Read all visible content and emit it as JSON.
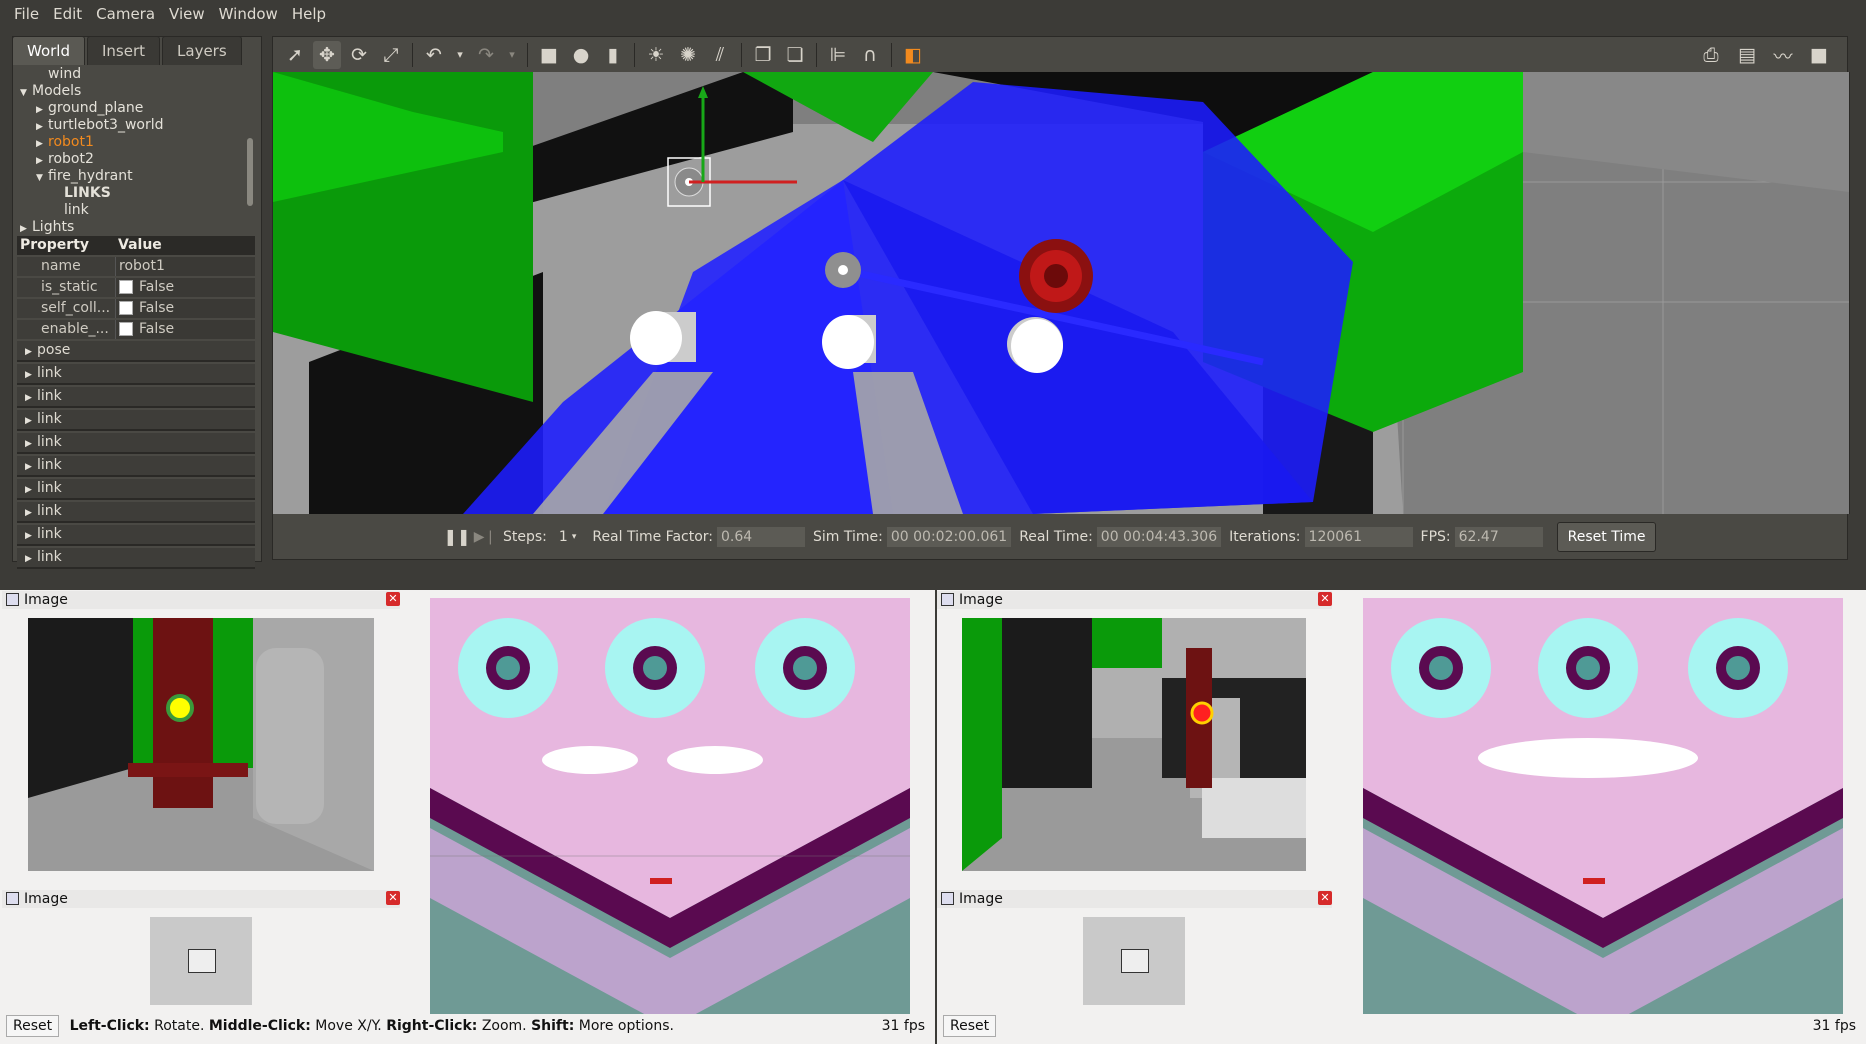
{
  "menu": [
    "File",
    "Edit",
    "Camera",
    "View",
    "Window",
    "Help"
  ],
  "tabs": [
    "World",
    "Insert",
    "Layers"
  ],
  "tree": [
    {
      "label": "wind",
      "indent": 1,
      "arrow": ""
    },
    {
      "label": "Models",
      "indent": 0,
      "arrow": "down"
    },
    {
      "label": "ground_plane",
      "indent": 1,
      "arrow": "right"
    },
    {
      "label": "turtlebot3_world",
      "indent": 1,
      "arrow": "right"
    },
    {
      "label": "robot1",
      "indent": 1,
      "arrow": "right",
      "selected": true
    },
    {
      "label": "robot2",
      "indent": 1,
      "arrow": "right"
    },
    {
      "label": "fire_hydrant",
      "indent": 1,
      "arrow": "down"
    },
    {
      "label": "LINKS",
      "indent": 2,
      "arrow": "",
      "bold": true
    },
    {
      "label": "link",
      "indent": 2,
      "arrow": ""
    },
    {
      "label": "Lights",
      "indent": 0,
      "arrow": "right"
    }
  ],
  "props": {
    "header": [
      "Property",
      "Value"
    ],
    "rows": [
      {
        "name": "name",
        "value": "robot1",
        "check": false
      },
      {
        "name": "is_static",
        "value": "False",
        "check": true
      },
      {
        "name": "self_coll...",
        "value": "False",
        "check": true
      },
      {
        "name": "enable_...",
        "value": "False",
        "check": true
      }
    ],
    "groups": [
      "pose",
      "link",
      "link",
      "link",
      "link",
      "link",
      "link",
      "link",
      "link",
      "link"
    ]
  },
  "bottombar": {
    "steps_label": "Steps:",
    "steps_value": "1",
    "rtf_label": "Real Time Factor:",
    "rtf_value": "0.64",
    "sim_label": "Sim Time:",
    "sim_value": "00 00:02:00.061",
    "real_label": "Real Time:",
    "real_value": "00 00:04:43.306",
    "iter_label": "Iterations:",
    "iter_value": "120061",
    "fps_label": "FPS:",
    "fps_value": "62.47",
    "reset_label": "Reset Time"
  },
  "panes": {
    "image_title": "Image",
    "reset": "Reset",
    "help_left_click": "Left-Click:",
    "help_rotate": "Rotate.",
    "help_middle_click": "Middle-Click:",
    "help_move": "Move X/Y.",
    "help_right_click": "Right-Click:",
    "help_zoom": "Zoom.",
    "help_shift": "Shift:",
    "help_more": "More options.",
    "fps_left": "31 fps",
    "fps_right": "31 fps"
  },
  "colors": {
    "accent": "#f28a1e",
    "wall_green": "#0dbd0d",
    "laser_blue": "#1d1dff"
  }
}
